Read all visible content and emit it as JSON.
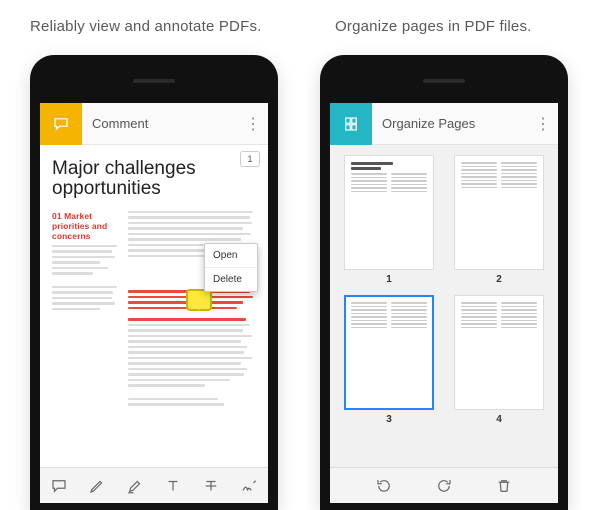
{
  "captions": {
    "left": "Reliably view and annotate PDFs.",
    "right": "Organize pages in PDF files."
  },
  "left_screen": {
    "accent_color": "#f4b400",
    "topbar_title": "Comment",
    "page_indicator": "1",
    "doc_title": "Major challenges opportunities",
    "section_heading": "01 Market priorities and concerns",
    "context_menu": {
      "open": "Open",
      "delete": "Delete"
    },
    "toolbar_icons": [
      "speech-bubble-icon",
      "pencil-icon",
      "highlighter-icon",
      "text-icon",
      "strikethrough-icon",
      "signature-icon"
    ]
  },
  "right_screen": {
    "accent_color": "#25b6c6",
    "topbar_title": "Organize Pages",
    "thumbnails": [
      {
        "label": "1",
        "selected": false
      },
      {
        "label": "2",
        "selected": false
      },
      {
        "label": "3",
        "selected": true
      },
      {
        "label": "4",
        "selected": false
      }
    ],
    "bottom_icons": [
      "rotate-ccw-icon",
      "rotate-cw-icon",
      "trash-icon"
    ]
  }
}
